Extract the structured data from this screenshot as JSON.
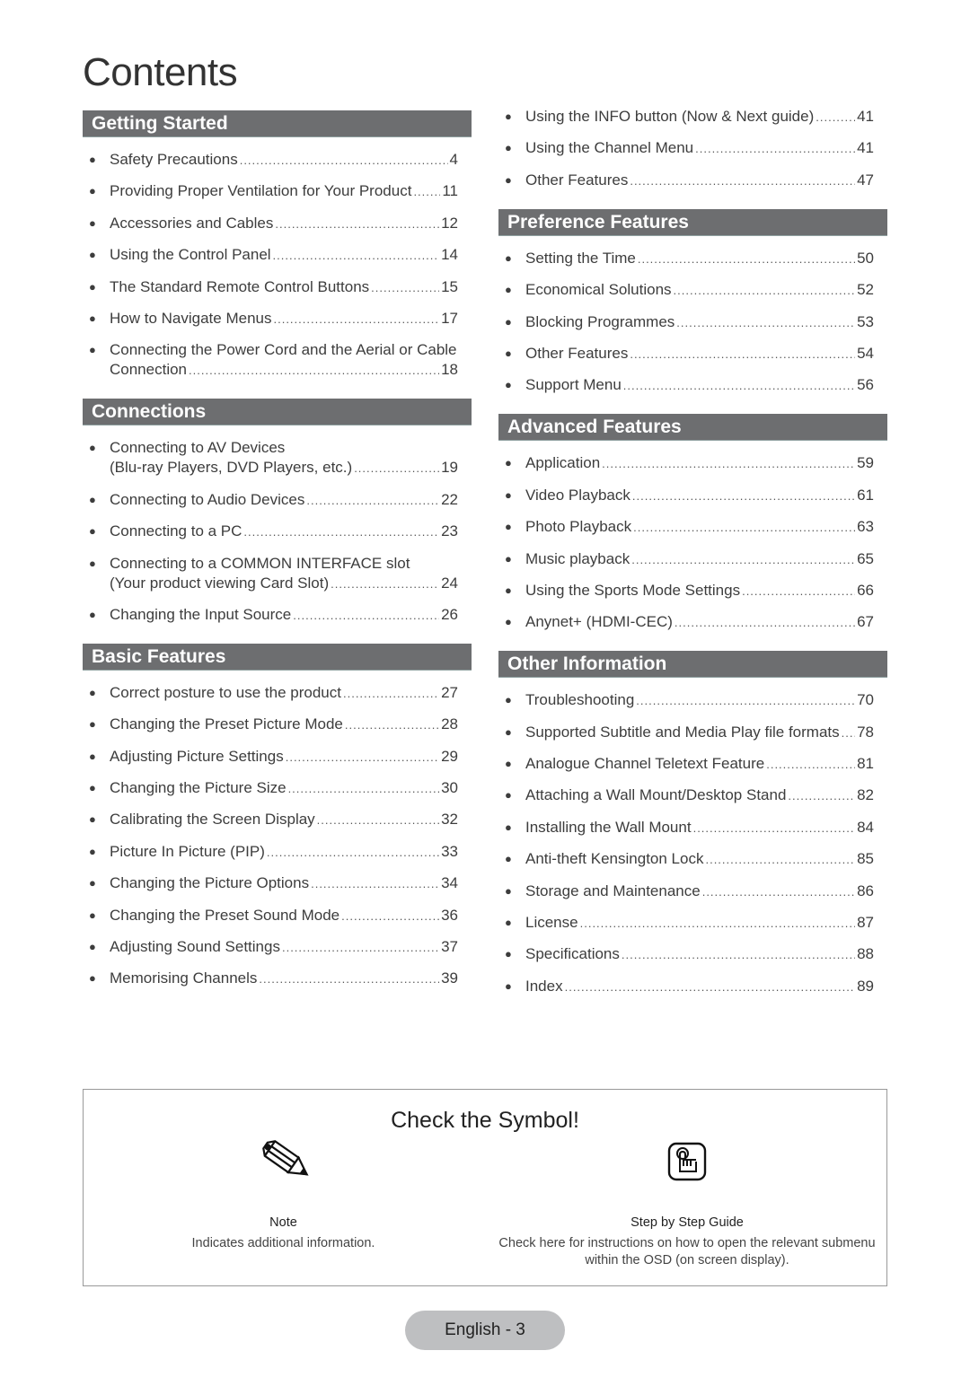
{
  "title": "Contents",
  "left_column": [
    {
      "header": "Getting Started",
      "items": [
        {
          "label": "Safety Precautions",
          "page": "4"
        },
        {
          "label": "Providing Proper Ventilation for Your Product",
          "page": "11"
        },
        {
          "label": "Accessories and Cables",
          "page": "12"
        },
        {
          "label": "Using the Control Panel",
          "page": "14"
        },
        {
          "label": "The Standard Remote Control Buttons",
          "page": "15"
        },
        {
          "label": "How to Navigate Menus",
          "page": "17"
        },
        {
          "first_line": "Connecting the Power Cord and the Aerial or Cable",
          "label": "Connection",
          "page": "18"
        }
      ]
    },
    {
      "header": "Connections",
      "items": [
        {
          "first_line": "Connecting to AV Devices",
          "label": "(Blu-ray Players, DVD Players, etc.)",
          "page": "19"
        },
        {
          "label": "Connecting to Audio Devices",
          "page": "22"
        },
        {
          "label": "Connecting to a PC",
          "page": "23"
        },
        {
          "first_line": "Connecting to a COMMON INTERFACE slot",
          "label": "(Your product viewing Card Slot)",
          "page": "24"
        },
        {
          "label": "Changing the Input Source",
          "page": "26"
        }
      ]
    },
    {
      "header": "Basic Features",
      "items": [
        {
          "label": "Correct posture to use the product",
          "page": "27"
        },
        {
          "label": "Changing the Preset Picture Mode",
          "page": "28"
        },
        {
          "label": "Adjusting Picture Settings",
          "page": "29"
        },
        {
          "label": "Changing the Picture Size",
          "page": "30"
        },
        {
          "label": "Calibrating the Screen Display",
          "page": "32"
        },
        {
          "label": "Picture In Picture (PIP)",
          "page": "33"
        },
        {
          "label": "Changing the Picture Options",
          "page": "34"
        },
        {
          "label": "Changing the Preset Sound Mode",
          "page": "36"
        },
        {
          "label": "Adjusting Sound Settings",
          "page": "37"
        },
        {
          "label": "Memorising Channels",
          "page": "39"
        }
      ]
    }
  ],
  "right_column": [
    {
      "header": "",
      "items": [
        {
          "label": "Using the INFO button (Now & Next guide)",
          "page": "41"
        },
        {
          "label": "Using the Channel Menu",
          "page": "41"
        },
        {
          "label": "Other Features",
          "page": "47"
        }
      ]
    },
    {
      "header": "Preference Features",
      "items": [
        {
          "label": "Setting the Time",
          "page": "50"
        },
        {
          "label": "Economical Solutions",
          "page": "52"
        },
        {
          "label": "Blocking Programmes",
          "page": "53"
        },
        {
          "label": "Other Features",
          "page": "54"
        },
        {
          "label": "Support Menu",
          "page": "56"
        }
      ]
    },
    {
      "header": "Advanced Features",
      "items": [
        {
          "label": "Application",
          "page": "59"
        },
        {
          "label": "Video Playback",
          "page": "61"
        },
        {
          "label": "Photo Playback",
          "page": "63"
        },
        {
          "label": "Music playback",
          "page": "65"
        },
        {
          "label": "Using the Sports Mode Settings",
          "page": "66"
        },
        {
          "label": "Anynet+ (HDMI-CEC)",
          "page": "67"
        }
      ]
    },
    {
      "header": "Other Information",
      "items": [
        {
          "label": "Troubleshooting",
          "page": "70"
        },
        {
          "label": "Supported Subtitle and Media Play file formats",
          "page": "78"
        },
        {
          "label": "Analogue Channel Teletext Feature",
          "page": "81"
        },
        {
          "label": "Attaching a Wall Mount/Desktop Stand",
          "page": "82"
        },
        {
          "label": "Installing the Wall Mount",
          "page": "84"
        },
        {
          "label": "Anti-theft Kensington Lock",
          "page": "85"
        },
        {
          "label": "Storage and Maintenance",
          "page": "86"
        },
        {
          "label": "License",
          "page": "87"
        },
        {
          "label": "Specifications",
          "page": "88"
        },
        {
          "label": "Index",
          "page": "89"
        }
      ]
    }
  ],
  "symbols": {
    "title": "Check the Symbol!",
    "note": {
      "icon": "pencil-icon",
      "name": "Note",
      "description": "Indicates additional information."
    },
    "step": {
      "icon": "finger-press-icon",
      "name": "Step by Step Guide",
      "description": "Check here for instructions on how to open the relevant submenu within the OSD (on screen display)."
    }
  },
  "footer": {
    "page_label": "English - 3"
  },
  "colors": {
    "section_header_bg": "#6d6e70",
    "footer_badge_bg": "#bebfc1"
  }
}
